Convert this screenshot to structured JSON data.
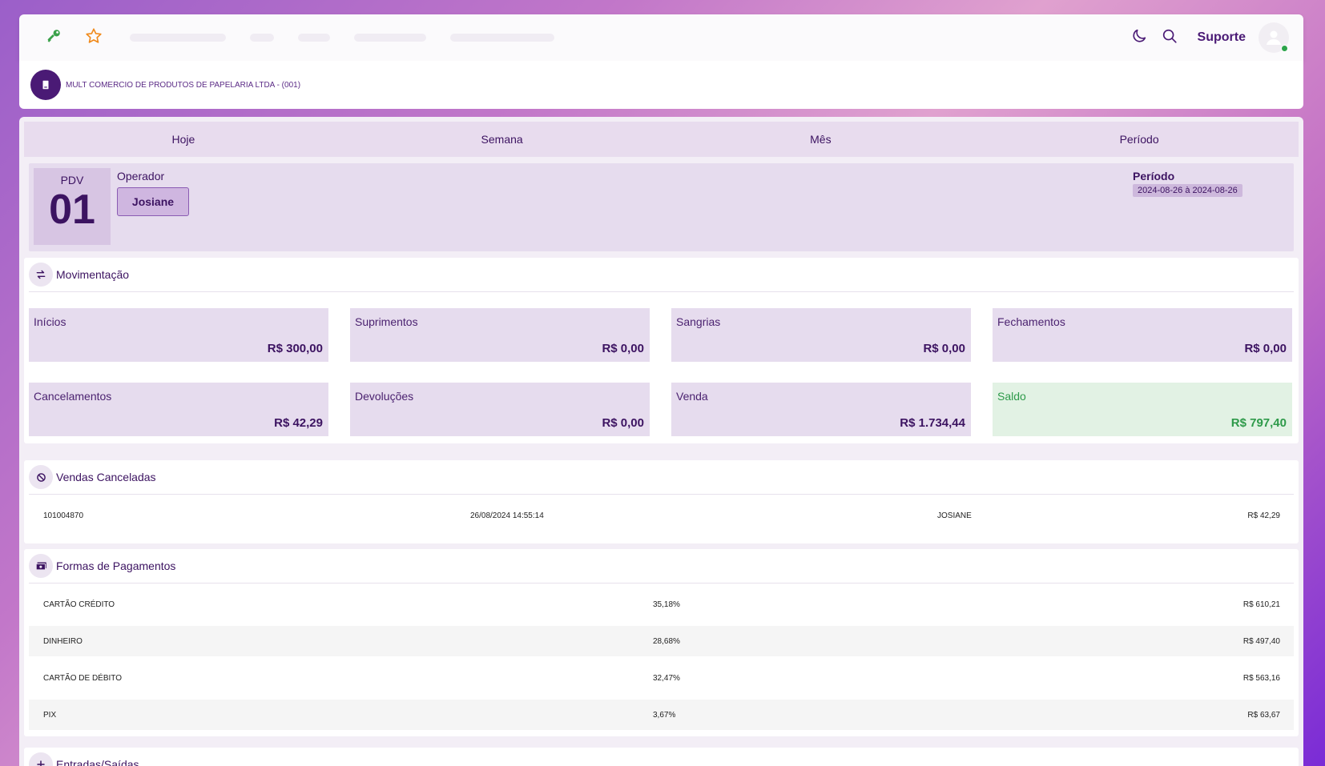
{
  "topbar": {
    "support_label": "Suporte"
  },
  "company": {
    "name": "MULT COMERCIO DE PRODUTOS DE PAPELARIA LTDA - (001)"
  },
  "tabs": [
    "Hoje",
    "Semana",
    "Mês",
    "Período"
  ],
  "pdv": {
    "label": "PDV",
    "number": "01",
    "operator_label": "Operador",
    "operator_name": "Josiane",
    "period_label": "Período",
    "period_value": "2024-08-26 à 2024-08-26"
  },
  "movimentacao": {
    "title": "Movimentação",
    "tiles": [
      {
        "label": "Inícios",
        "value": "R$ 300,00"
      },
      {
        "label": "Suprimentos",
        "value": "R$ 0,00"
      },
      {
        "label": "Sangrias",
        "value": "R$ 0,00"
      },
      {
        "label": "Fechamentos",
        "value": "R$ 0,00"
      },
      {
        "label": "Cancelamentos",
        "value": "R$ 42,29"
      },
      {
        "label": "Devoluções",
        "value": "R$ 0,00"
      },
      {
        "label": "Venda",
        "value": "R$ 1.734,44"
      },
      {
        "label": "Saldo",
        "value": "R$ 797,40"
      }
    ]
  },
  "vendas_canceladas": {
    "title": "Vendas Canceladas",
    "rows": [
      {
        "id": "101004870",
        "datetime": "26/08/2024 14:55:14",
        "operator": "JOSIANE",
        "value": "R$ 42,29"
      }
    ]
  },
  "pagamentos": {
    "title": "Formas de Pagamentos",
    "rows": [
      {
        "method": "CARTÃO CRÉDITO",
        "percent": "35,18%",
        "value": "R$ 610,21"
      },
      {
        "method": "DINHEIRO",
        "percent": "28,68%",
        "value": "R$ 497,40"
      },
      {
        "method": "CARTÃO DE DÉBITO",
        "percent": "32,47%",
        "value": "R$ 563,16"
      },
      {
        "method": "PIX",
        "percent": "3,67%",
        "value": "R$ 63,67"
      }
    ]
  },
  "entradas": {
    "title": "Entradas/Saídas"
  },
  "colors": {
    "primary": "#3c1361",
    "tile_bg": "#e6dcee",
    "success": "#2e9a4a",
    "online": "#2ca34a"
  }
}
